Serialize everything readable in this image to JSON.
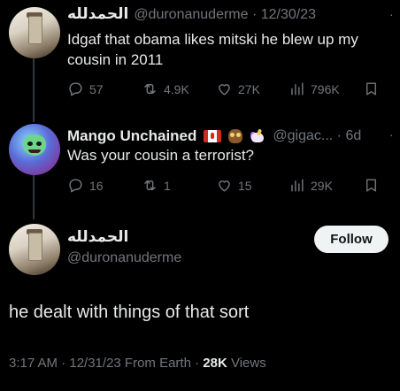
{
  "tweet1": {
    "name": "الحمدلله",
    "handle_time": "@duronanuderme · 12/30/23",
    "text": "Idgaf that obama likes mitski he blew up my cousin in 2011",
    "replies": "57",
    "retweets": "4.9K",
    "likes": "27K",
    "views": "796K"
  },
  "tweet2": {
    "name": "Mango Unchained",
    "badges": [
      "canada-flag-emoji",
      "owl-emoji",
      "unicorn-emoji"
    ],
    "handle_time": "@gigac... · 6d",
    "text": "Was your cousin a terrorist?",
    "replies": "16",
    "retweets": "1",
    "likes": "15",
    "views": "29K"
  },
  "main": {
    "name": "الحمدلله",
    "handle": "@duronanuderme",
    "follow_label": "Follow",
    "text": "he dealt with things of that sort",
    "meta": "3:17 AM · 12/31/23 From Earth · ",
    "views_count": "28K",
    "views_label": " Views"
  },
  "colors": {
    "background": "#000000",
    "primary_text": "#e7e9ea",
    "secondary_text": "#71767b",
    "button_bg": "#eff3f4"
  }
}
